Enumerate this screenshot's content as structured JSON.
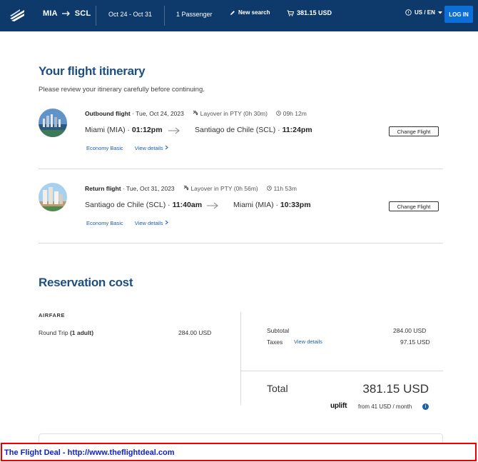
{
  "header": {
    "origin": "MIA",
    "destination": "SCL",
    "dates": "Oct 24 - Oct 31",
    "passengers": "1 Passenger",
    "new_search": "New search",
    "cart_total": "381.15 USD",
    "locale": "US / EN",
    "login": "LOG IN"
  },
  "itinerary": {
    "title": "Your flight itinerary",
    "subtitle": "Please review your itinerary carefully before continuing.",
    "flights": [
      {
        "type_label": "Outbound flight",
        "date": "Tue, Oct 24, 2023",
        "layover": "Layover in PTY (0h 30m)",
        "duration": "09h 12m",
        "from": "Miami (MIA)",
        "depart_time": "01:12pm",
        "to": "Santiago de Chile (SCL)",
        "arrive_time": "11:24pm",
        "fare_class": "Economy Basic",
        "details_link": "View details",
        "change_button": "Change Flight"
      },
      {
        "type_label": "Return flight",
        "date": "Tue, Oct 31, 2023",
        "layover": "Layover in PTY (0h 56m)",
        "duration": "11h 53m",
        "from": "Santiago de Chile (SCL)",
        "depart_time": "11:40am",
        "to": "Miami (MIA)",
        "arrive_time": "10:33pm",
        "fare_class": "Economy Basic",
        "details_link": "View details",
        "change_button": "Change Flight"
      }
    ]
  },
  "cost": {
    "title": "Reservation cost",
    "airfare_label": "AIRFARE",
    "round_trip_label": "Round Trip",
    "round_trip_qty": "(1 adult)",
    "round_trip_price": "284.00 USD",
    "subtotal_label": "Subtotal",
    "subtotal_value": "284.00 USD",
    "taxes_label": "Taxes",
    "taxes_link": "View details",
    "taxes_value": "97.15 USD",
    "total_label": "Total",
    "total_value": "381.15 USD",
    "uplift_logo": "uplift",
    "uplift_text": "from 41 USD / month"
  },
  "banner": {
    "text": "The Flight Deal - http://www.theflightdeal.com"
  },
  "colors": {
    "header_bg": "#0e3a6b",
    "title_blue": "#1d4f80",
    "link_blue": "#1a5fb4",
    "login_bg": "#0c6fd8",
    "banner_border": "#ee0000",
    "banner_text": "#1020d0"
  }
}
